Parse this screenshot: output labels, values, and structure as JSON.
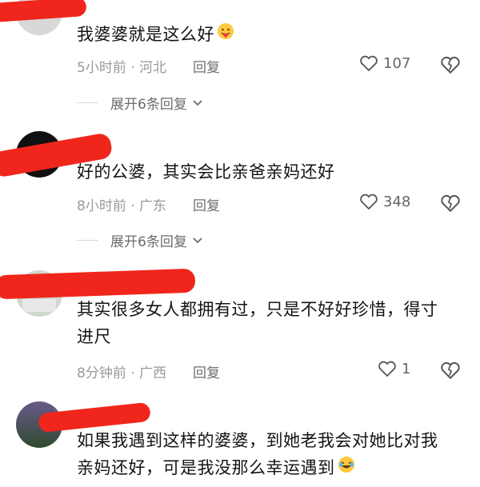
{
  "comments": [
    {
      "text": "我婆婆就是这么好",
      "time_location": "5小时前 · 河北",
      "reply_label": "回复",
      "like_count": "107",
      "expand_label": "展开6条回复",
      "emoji": "hug-heart-emoji"
    },
    {
      "text": "好的公婆，其实会比亲爸亲妈还好",
      "time_location": "8小时前 · 广东",
      "reply_label": "回复",
      "like_count": "348",
      "expand_label": "展开6条回复"
    },
    {
      "text_line1": "其实很多女人都拥有过，只是不好好珍惜，得寸",
      "text_line2": "进尺",
      "time_location": "8分钟前 · 广西",
      "reply_label": "回复",
      "like_count": "1"
    },
    {
      "text_line1": "如果我遇到这样的婆婆，到她老我会对她比对我",
      "text_line2": "亲妈还好，可是我没那么幸运遇到",
      "emoji": "rofl-emoji"
    }
  ],
  "icons": {
    "like": "heart-outline-icon",
    "dislike": "broken-heart-icon",
    "chevron": "chevron-down-icon"
  },
  "colors": {
    "redaction": "#f0261c",
    "text": "#141414",
    "meta": "#9a9a9a"
  }
}
